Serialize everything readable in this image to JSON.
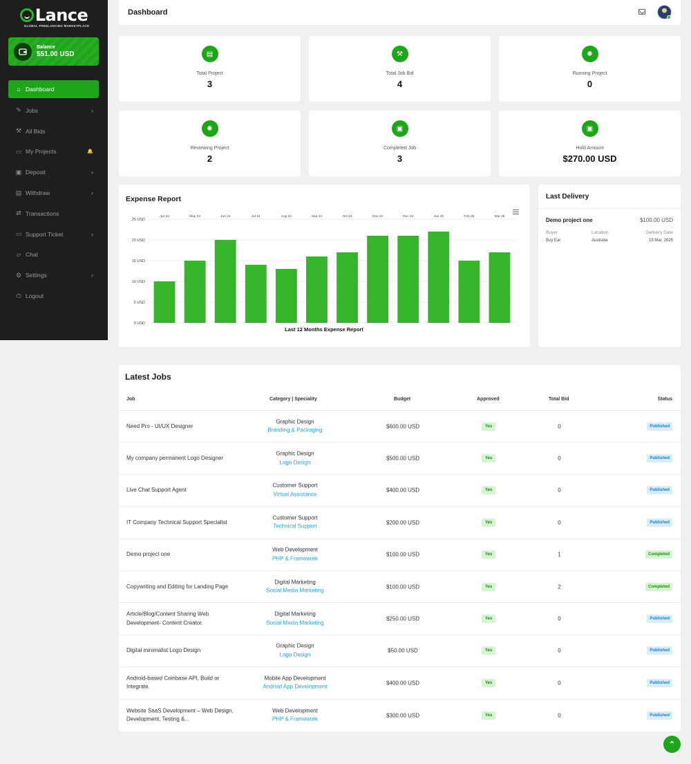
{
  "brand": {
    "name": "Lance",
    "tagline": "GLOBAL FREELANCING MARKETPLACE"
  },
  "balance": {
    "label": "Balance",
    "value": "$51.00 USD"
  },
  "sidebar": {
    "items": [
      {
        "label": "Dashboard",
        "icon": "home-icon",
        "glyph": "⌂"
      },
      {
        "label": "Jobs",
        "icon": "link-icon",
        "glyph": "✎"
      },
      {
        "label": "All Bids",
        "icon": "gavel-icon",
        "glyph": "⚒"
      },
      {
        "label": "My Projects",
        "icon": "folder-icon",
        "glyph": "▭"
      },
      {
        "label": "Deposit",
        "icon": "wallet-icon",
        "glyph": "▣"
      },
      {
        "label": "Withdraw",
        "icon": "cash-icon",
        "glyph": "▤"
      },
      {
        "label": "Transactions",
        "icon": "exchange-icon",
        "glyph": "⇄"
      },
      {
        "label": "Support Ticket",
        "icon": "ticket-icon",
        "glyph": "▭"
      },
      {
        "label": "Chat",
        "icon": "chat-icon",
        "glyph": "▱"
      },
      {
        "label": "Settings",
        "icon": "gear-icon",
        "glyph": "⚙"
      },
      {
        "label": "Logout",
        "icon": "logout-icon",
        "glyph": "⏻"
      }
    ]
  },
  "header": {
    "title": "Dashboard"
  },
  "stats": [
    {
      "label": "Total Project",
      "value": "3",
      "icon": "money-icon"
    },
    {
      "label": "Total Job Bid",
      "value": "4",
      "icon": "gavel-icon"
    },
    {
      "label": "Running Project",
      "value": "0",
      "icon": "spinner-icon"
    },
    {
      "label": "Reviewing Project",
      "value": "2",
      "icon": "spinner-icon"
    },
    {
      "label": "Completed Job",
      "value": "3",
      "icon": "briefcase-icon"
    },
    {
      "label": "Hold Amount",
      "value": "$270.00 USD",
      "icon": "briefcase-icon"
    }
  ],
  "expense": {
    "title": "Expense Report"
  },
  "chart_data": {
    "type": "bar",
    "categories": [
      "Apr 24",
      "May 24",
      "Jun 24",
      "Jul 24",
      "Aug 24",
      "Sep 24",
      "Oct 24",
      "Nov 24",
      "Dec 24",
      "Jan 25",
      "Feb 25",
      "Mar 25"
    ],
    "values": [
      10,
      15,
      20,
      14,
      13,
      16,
      17,
      21,
      21,
      22,
      15,
      17
    ],
    "ylim": [
      0,
      25
    ],
    "yticks": [
      "25 USD",
      "20 USD",
      "15 USD",
      "10 USD",
      "5 USD",
      "0 USD"
    ],
    "xlabel": "Last 12 Months Expense Report",
    "bar_color": "#36b52a",
    "grid": true
  },
  "delivery": {
    "title": "Last Delivery",
    "project": "Demo project one",
    "price": "$100.00 USD",
    "headers": [
      "Buyer",
      "Location",
      "Delivery Date"
    ],
    "values": [
      "Buy Ear",
      "Australia",
      "19 Mar, 2025"
    ]
  },
  "jobs": {
    "title": "Latest Jobs",
    "columns": [
      "Job",
      "Category | Speciality",
      "Budget",
      "Approved",
      "Total Bid",
      "Status"
    ],
    "rows": [
      {
        "job": "Need Pro - UI/UX Designer",
        "category": "Graphic Design",
        "speciality": "Branding & Packaging",
        "budget": "$600.00 USD",
        "approved": "Yes",
        "bids": "0",
        "status": "Published"
      },
      {
        "job": "My company permanent Logo Designer",
        "category": "Graphic Design",
        "speciality": "Logo Design",
        "budget": "$500.00 USD",
        "approved": "Yes",
        "bids": "0",
        "status": "Published"
      },
      {
        "job": "Live Chat Support Agent",
        "category": "Customer Support",
        "speciality": "Virtual Assistance",
        "budget": "$400.00 USD",
        "approved": "Yes",
        "bids": "0",
        "status": "Published"
      },
      {
        "job": "IT Company Technical Support Specialist",
        "category": "Customer Support",
        "speciality": "Technical Support",
        "budget": "$200.00 USD",
        "approved": "Yes",
        "bids": "0",
        "status": "Published"
      },
      {
        "job": "Demo project one",
        "category": "Web Development",
        "speciality": "PHP & Framework",
        "budget": "$100.00 USD",
        "approved": "Yes",
        "bids": "1",
        "status": "Completed"
      },
      {
        "job": "Copywriting and Editing for Landing Page",
        "category": "Digital Marketing",
        "speciality": "Social Media Marketing",
        "budget": "$100.00 USD",
        "approved": "Yes",
        "bids": "2",
        "status": "Completed"
      },
      {
        "job": "Article/Blog/Content Sharing Web Development- Content Creator.",
        "category": "Digital Marketing",
        "speciality": "Social Media Marketing",
        "budget": "$250.00 USD",
        "approved": "Yes",
        "bids": "0",
        "status": "Published"
      },
      {
        "job": "Digital minimalist Logo Design",
        "category": "Graphic Design",
        "speciality": "Logo Design",
        "budget": "$50.00 USD",
        "approved": "Yes",
        "bids": "0",
        "status": "Published"
      },
      {
        "job": "Android-based Coinbase API, Build or Integrate.",
        "category": "Mobile App Development",
        "speciality": "Android App Development",
        "budget": "$400.00 USD",
        "approved": "Yes",
        "bids": "0",
        "status": "Published"
      },
      {
        "job": "Website SaaS Development – Web Design, Development, Testing &...",
        "category": "Web Development",
        "speciality": "PHP & Framework",
        "budget": "$300.00 USD",
        "approved": "Yes",
        "bids": "0",
        "status": "Published"
      }
    ]
  },
  "colors": {
    "accent": "#1ea51a",
    "sidebar": "#1e1e1e",
    "link": "#23a2e8"
  }
}
